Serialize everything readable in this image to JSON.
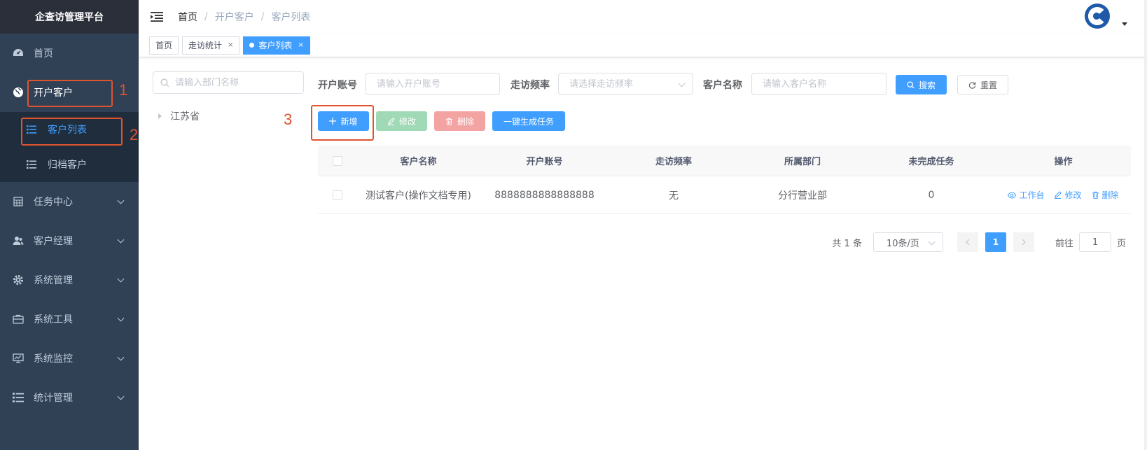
{
  "app": {
    "title": "企查访管理平台"
  },
  "sidebar": {
    "items": [
      {
        "label": "首页",
        "icon": "dashboard-icon"
      },
      {
        "label": "开户客户",
        "icon": "globe-icon"
      },
      {
        "label": "任务中心",
        "icon": "table-icon"
      },
      {
        "label": "客户经理",
        "icon": "users-icon"
      },
      {
        "label": "系统管理",
        "icon": "gear-icon"
      },
      {
        "label": "系统工具",
        "icon": "toolbox-icon"
      },
      {
        "label": "系统监控",
        "icon": "monitor-icon"
      },
      {
        "label": "统计管理",
        "icon": "list-icon"
      }
    ],
    "sub_items": [
      {
        "label": "客户列表",
        "icon": "list-icon"
      },
      {
        "label": "归档客户",
        "icon": "list-icon"
      }
    ]
  },
  "annotations": [
    "1",
    "2",
    "3"
  ],
  "breadcrumb": [
    "首页",
    "开户客户",
    "客户列表"
  ],
  "breadcrumb_sep": "/",
  "tags": [
    {
      "label": "首页"
    },
    {
      "label": "走访统计",
      "close": "×"
    },
    {
      "label": "客户列表",
      "close": "×"
    }
  ],
  "dept": {
    "search_placeholder": "请输入部门名称",
    "tree_root": "江苏省"
  },
  "filters": {
    "account_label": "开户账号",
    "account_placeholder": "请输入开户账号",
    "freq_label": "走访频率",
    "freq_placeholder": "请选择走访频率",
    "name_label": "客户名称",
    "name_placeholder": "请输入客户名称",
    "search_btn": "搜索",
    "reset_btn": "重置"
  },
  "toolbar": {
    "add": "新增",
    "edit": "修改",
    "delete": "删除",
    "generate": "一键生成任务"
  },
  "table": {
    "columns": [
      "客户名称",
      "开户账号",
      "走访频率",
      "所属部门",
      "未完成任务",
      "操作"
    ],
    "rows": [
      {
        "name": "测试客户(操作文档专用)",
        "account": "8888888888888888",
        "frequency": "无",
        "department": "分行营业部",
        "pending": "0",
        "ops": [
          "工作台",
          "修改",
          "删除"
        ]
      }
    ]
  },
  "pagination": {
    "total": "共 1 条",
    "page_size": "10条/页",
    "current": "1",
    "goto_label": "前往",
    "goto_value": "1",
    "page_unit": "页"
  },
  "colors": {
    "sidebar_bg": "#304156",
    "accent": "#409eff",
    "annotation": "#e0532f"
  }
}
